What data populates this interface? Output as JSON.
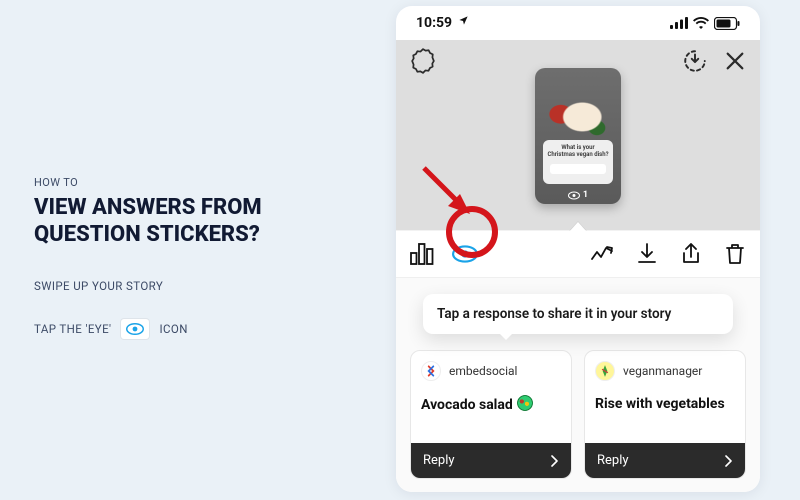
{
  "left": {
    "kicker": "HOW TO",
    "headline": "VIEW ANSWERS FROM QUESTION STICKERS?",
    "step1": "SWIPE UP YOUR STORY",
    "step2_a": "TAP THE 'EYE'",
    "step2_b": "ICON"
  },
  "status": {
    "time": "10:59"
  },
  "story": {
    "question": "What is your Christmas vegan dish?",
    "view_count": "1"
  },
  "tip": "Tap a response to share it in your story",
  "responses": [
    {
      "user": "embedsocial",
      "text": "Avocado salad",
      "reply": "Reply",
      "has_salad": true
    },
    {
      "user": "veganmanager",
      "text": "Rise with vegetables",
      "reply": "Reply",
      "has_salad": false
    }
  ]
}
